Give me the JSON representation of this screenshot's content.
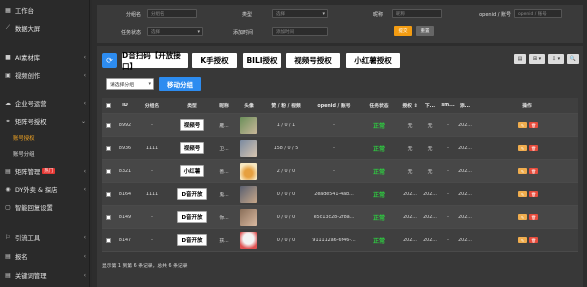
{
  "sidebar": {
    "items": [
      {
        "label": "工作台",
        "icon": "dashboard-icon"
      },
      {
        "label": "数据大屏",
        "icon": "chart-icon"
      },
      {
        "label": "AI素材库",
        "icon": "folder-icon"
      },
      {
        "label": "视频创作",
        "icon": "video-icon"
      },
      {
        "label": "企业号运营",
        "icon": "cloud-icon"
      },
      {
        "label": "矩阵号授权",
        "icon": "link-icon"
      },
      {
        "label": "矩阵管理",
        "icon": "list-icon",
        "badge": "热门"
      },
      {
        "label": "DY外卖 & 探店",
        "icon": "food-icon"
      },
      {
        "label": "智能回复设置",
        "icon": "chat-icon"
      },
      {
        "label": "引流工具",
        "icon": "tool-icon"
      },
      {
        "label": "报名",
        "icon": "signup-icon"
      },
      {
        "label": "关键词管理",
        "icon": "key-icon"
      }
    ],
    "subitems": [
      {
        "label": "账号授权",
        "active": true
      },
      {
        "label": "账号分组",
        "active": false
      }
    ]
  },
  "filters": {
    "group_label": "分组名",
    "group_placeholder": "分组名",
    "type_label": "类型",
    "type_value": "选择",
    "nickname_label": "昵称",
    "nickname_placeholder": "昵称",
    "openid_label": "openid / 账号",
    "openid_placeholder": "openid / 账号",
    "task_label": "任务状态",
    "task_value": "选择",
    "addtime_label": "添加时间",
    "addtime_placeholder": "添加时间",
    "search_btn": "提交",
    "reset_btn": "重置"
  },
  "toolbar": {
    "refresh_icon": "⟳",
    "buttons": [
      "D音扫码【开放接口】",
      "K手授权",
      "BILI授权",
      "视频号授权",
      "小红薯授权"
    ],
    "right_tools": [
      "▤",
      "⊞ ▾",
      "⇩ ▾",
      "🔍"
    ],
    "group_select": "请选择分组",
    "move_btn": "移动分组"
  },
  "table": {
    "headers": [
      "ID",
      "分组名",
      "类型",
      "昵称",
      "头像",
      "赞 / 粉 / 视频",
      "openid / 账号",
      "任务状态",
      "授权 ⇕",
      "下...",
      "sm...",
      "添...",
      "操作"
    ],
    "rows": [
      {
        "id": "8992",
        "group": "-",
        "type": "视频号",
        "nick": "雁...",
        "avatar": "avatar-portrait",
        "stats": "1 / 0 / 1",
        "openid": "-",
        "status": "正常",
        "auth": "无",
        "down": "无",
        "sm": "-",
        "add": "202...",
        "c1": "#6b8f5a",
        "c2": "#c9b79a"
      },
      {
        "id": "8936",
        "group": "1111",
        "type": "视频号",
        "nick": "卫...",
        "avatar": "avatar-portrait",
        "stats": "158 / 0 / 5",
        "openid": "-",
        "status": "正常",
        "auth": "无",
        "down": "无",
        "sm": "-",
        "add": "202...",
        "c1": "#7a8aa0",
        "c2": "#d8c6b0"
      },
      {
        "id": "8321",
        "group": "-",
        "type": "小红薯",
        "nick": "善...",
        "avatar": "avatar-cartoon",
        "stats": "2 / 0 / 0",
        "openid": "-",
        "status": "正常",
        "auth": "无",
        "down": "无",
        "sm": "-",
        "add": "202...",
        "c1": "#f7e7c0",
        "c2": "#e6a040"
      },
      {
        "id": "8164",
        "group": "1111",
        "type": "D音开放",
        "nick": "鬼...",
        "avatar": "avatar-portrait",
        "stats": "0 / 0 / 0",
        "openid": "2eade541-4ab...",
        "status": "正常",
        "auth": "202...",
        "down": "202...",
        "sm": "-",
        "add": "202...",
        "c1": "#5a6070",
        "c2": "#c7a789"
      },
      {
        "id": "8149",
        "group": "-",
        "type": "D音开放",
        "nick": "你...",
        "avatar": "avatar-portrait",
        "stats": "0 / 0 / 0",
        "openid": "e5c13c28-2f8a...",
        "status": "正常",
        "auth": "202...",
        "down": "202...",
        "sm": "-",
        "add": "202...",
        "c1": "#8a6f5a",
        "c2": "#d9b9a0"
      },
      {
        "id": "8147",
        "group": "-",
        "type": "D音开放",
        "nick": "孩...",
        "avatar": "avatar-cartoon",
        "stats": "0 / 0 / 0",
        "openid": "911112a6-6f46-...",
        "status": "正常",
        "auth": "202...",
        "down": "202...",
        "sm": "-",
        "add": "202...",
        "c1": "#f3f3f3",
        "c2": "#e05050"
      }
    ],
    "footer": "显示第 1 到第 6 条记录，总共 6 条记录"
  }
}
